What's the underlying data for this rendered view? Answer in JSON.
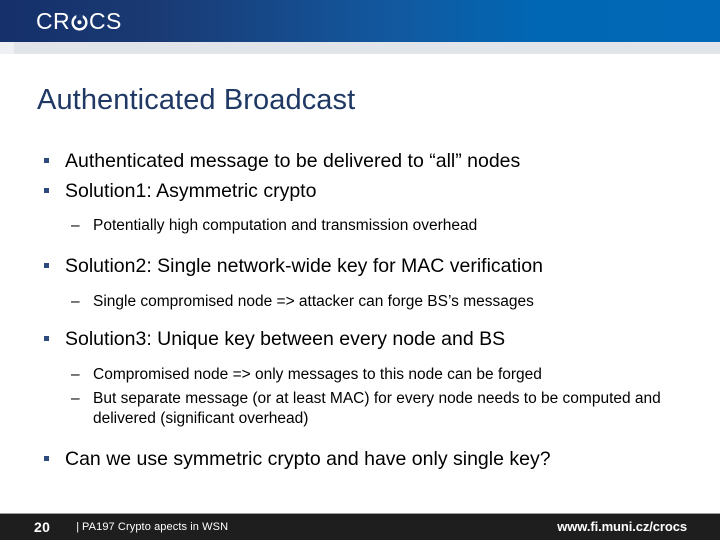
{
  "brand": {
    "logo_text_before": "CR",
    "logo_mark_icon": "crocs-circle-dot-icon",
    "logo_text_after": "CS",
    "header_gradient_start": "#15306a",
    "header_gradient_end": "#0068b6"
  },
  "slide": {
    "title": "Authenticated Broadcast",
    "title_color": "#1f3864",
    "body_color": "#000000",
    "bullet_color": "#2e4a7d",
    "blocks": [
      {
        "level": 1,
        "marker": "square-bullet",
        "text": "Authenticated message to be delivered to “all” nodes"
      },
      {
        "level": 1,
        "marker": "square-bullet",
        "text": "Solution1: Asymmetric crypto"
      },
      {
        "level": 2,
        "marker": "en-dash",
        "text": "Potentially high computation and transmission overhead"
      },
      {
        "level": 1,
        "marker": "square-bullet",
        "text": "Solution2: Single network-wide key for MAC verification"
      },
      {
        "level": 2,
        "marker": "en-dash",
        "text": "Single compromised node => attacker can forge BS’s messages"
      },
      {
        "level": 1,
        "marker": "square-bullet",
        "text": "Solution3: Unique key between every node and BS"
      },
      {
        "level": 2,
        "marker": "en-dash",
        "text": "Compromised node => only messages to this node can be forged"
      },
      {
        "level": 2,
        "marker": "en-dash",
        "text": "But separate message (or at least MAC) for every node needs to be computed and delivered (significant overhead)"
      },
      {
        "level": 1,
        "marker": "square-bullet",
        "text": "Can we use symmetric crypto and have only single key?"
      }
    ]
  },
  "footer": {
    "page_number": "20",
    "separator": "|",
    "subtitle": "PA197 Crypto apects in WSN",
    "website": "www.fi.muni.cz/crocs",
    "background": "#1f1e1e"
  }
}
